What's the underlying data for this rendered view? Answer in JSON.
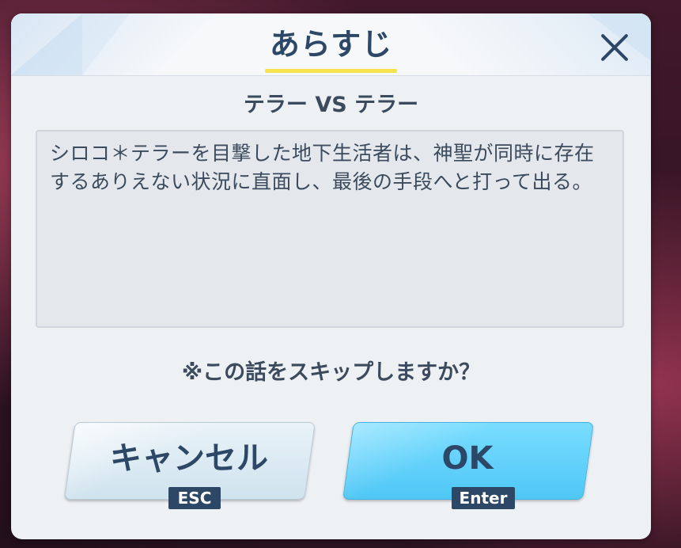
{
  "dialog": {
    "title": "あらすじ",
    "episode_title": "テラー VS テラー",
    "summary_lines": [
      "シロコ＊テラーを目撃した地下生活者は、神聖が同時に存在",
      "するありえない状況に直面し、最後の手段へと打って出る。"
    ],
    "confirm_text": "※この話をスキップしますか？",
    "close_icon": "close-icon"
  },
  "buttons": {
    "cancel_label": "キャンセル",
    "cancel_key": "ESC",
    "ok_label": "OK",
    "ok_key": "Enter"
  },
  "colors": {
    "title_text": "#2d4766",
    "title_underline": "#f6e24a",
    "ok_button": "#59cdf8",
    "cancel_button": "#dbe9f2",
    "key_badge": "#2d4766"
  }
}
